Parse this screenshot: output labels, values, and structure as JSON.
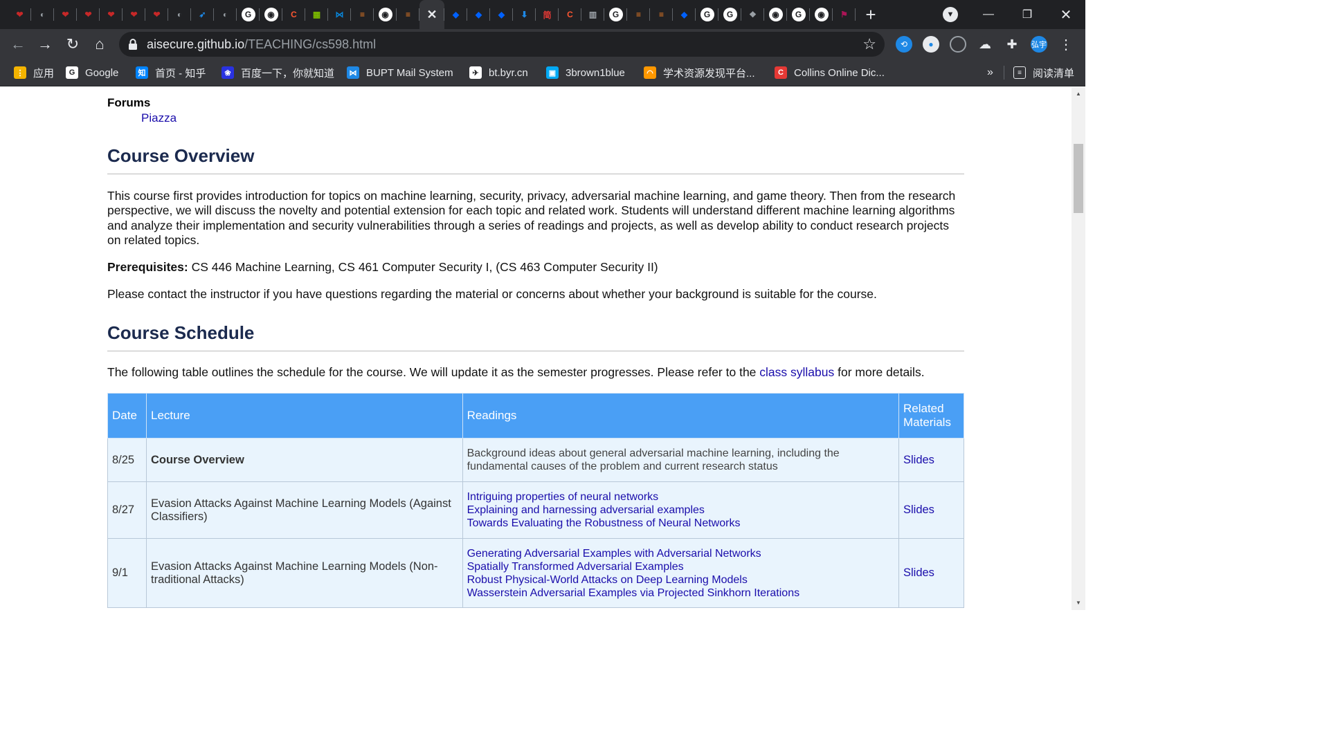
{
  "browser": {
    "tabs": [
      {
        "icon": "red-logo-icon",
        "color": "#c62828",
        "glyph": "❤"
      },
      {
        "icon": "globe-icon",
        "color": "#9aa0a6",
        "glyph": "◐"
      },
      {
        "icon": "red-logo-icon",
        "color": "#c62828",
        "glyph": "❤"
      },
      {
        "icon": "red-logo-icon",
        "color": "#c62828",
        "glyph": "❤"
      },
      {
        "icon": "red-logo-icon",
        "color": "#c62828",
        "glyph": "❤"
      },
      {
        "icon": "red-logo-icon",
        "color": "#c62828",
        "glyph": "❤"
      },
      {
        "icon": "red-logo-icon",
        "color": "#c62828",
        "glyph": "❤"
      },
      {
        "icon": "globe-icon",
        "color": "#9aa0a6",
        "glyph": "◐"
      },
      {
        "icon": "rocket-icon",
        "color": "#1e88e5",
        "glyph": "➶"
      },
      {
        "icon": "globe-icon",
        "color": "#9aa0a6",
        "glyph": "◐"
      },
      {
        "icon": "google-icon",
        "color": "#ffffff",
        "glyph": "G"
      },
      {
        "icon": "github-icon",
        "color": "#ffffff",
        "glyph": "◉"
      },
      {
        "icon": "csdn-icon",
        "color": "#fc5531",
        "glyph": "C"
      },
      {
        "icon": "microsoft-icon",
        "color": "#7cbb00",
        "glyph": "▦"
      },
      {
        "icon": "vscode-icon",
        "color": "#0a84d6",
        "glyph": "⋈"
      },
      {
        "icon": "stackoverflow-icon",
        "color": "#f48024",
        "glyph": "≡"
      },
      {
        "icon": "github-icon",
        "color": "#ffffff",
        "glyph": "◉"
      },
      {
        "icon": "stackoverflow-icon",
        "color": "#f48024",
        "glyph": "≡"
      },
      {
        "icon": "close-icon",
        "color": "#35363a",
        "glyph": "✕",
        "active": true
      },
      {
        "icon": "dropbox-icon",
        "color": "#0061fe",
        "glyph": "◆"
      },
      {
        "icon": "dropbox-icon",
        "color": "#0061fe",
        "glyph": "◆"
      },
      {
        "icon": "dropbox-icon",
        "color": "#0061fe",
        "glyph": "◆"
      },
      {
        "icon": "download-icon",
        "color": "#1e88e5",
        "glyph": "⬇"
      },
      {
        "icon": "jian-icon",
        "color": "#e53935",
        "glyph": "简"
      },
      {
        "icon": "csdn-icon",
        "color": "#fc5531",
        "glyph": "C"
      },
      {
        "icon": "reader-icon",
        "color": "#9aa0a6",
        "glyph": "▥"
      },
      {
        "icon": "google-icon",
        "color": "#ffffff",
        "glyph": "G"
      },
      {
        "icon": "stackoverflow-icon",
        "color": "#f48024",
        "glyph": "≡"
      },
      {
        "icon": "stackoverflow-icon",
        "color": "#f48024",
        "glyph": "≡"
      },
      {
        "icon": "dropbox-icon",
        "color": "#0061fe",
        "glyph": "◆"
      },
      {
        "icon": "google-icon",
        "color": "#ffffff",
        "glyph": "G"
      },
      {
        "icon": "google-icon",
        "color": "#ffffff",
        "glyph": "G"
      },
      {
        "icon": "python-icon",
        "color": "#9aa0a6",
        "glyph": "❖"
      },
      {
        "icon": "github-icon",
        "color": "#ffffff",
        "glyph": "◉"
      },
      {
        "icon": "google-icon",
        "color": "#ffffff",
        "glyph": "G"
      },
      {
        "icon": "github-icon",
        "color": "#ffffff",
        "glyph": "◉"
      },
      {
        "icon": "flag-icon",
        "color": "#ad1457",
        "glyph": "⚑"
      }
    ],
    "url_host": "aisecure.github.io",
    "url_path": "/TEACHING/cs598.html",
    "profile_label": "弘宇",
    "bookmarks": [
      {
        "label": "应用",
        "icon": "apps-grid-icon",
        "color": "#f4b400",
        "glyph": "⋮"
      },
      {
        "label": "Google",
        "icon": "google-icon",
        "color": "#ffffff",
        "glyph": "G"
      },
      {
        "label": "首页 - 知乎",
        "icon": "zhihu-icon",
        "color": "#0084ff",
        "glyph": "知"
      },
      {
        "label": "百度一下，你就知道",
        "icon": "baidu-icon",
        "color": "#2932e1",
        "glyph": "❀"
      },
      {
        "label": "BUPT Mail System",
        "icon": "mail-icon",
        "color": "#1e88e5",
        "glyph": "⋈"
      },
      {
        "label": "bt.byr.cn",
        "icon": "byr-icon",
        "color": "#ffffff",
        "glyph": "✈"
      },
      {
        "label": "3brown1blue",
        "icon": "tv-icon",
        "color": "#03a9f4",
        "glyph": "▣"
      },
      {
        "label": "学术资源发现平台...",
        "icon": "rainbow-icon",
        "color": "#ff9800",
        "glyph": "◠"
      },
      {
        "label": "Collins Online Dic...",
        "icon": "collins-icon",
        "color": "#e53935",
        "glyph": "C"
      }
    ],
    "more_bookmarks": "»",
    "reading_list": "阅读清单"
  },
  "page": {
    "forums_title": "Forums",
    "forums_link": "Piazza",
    "overview_title": "Course Overview",
    "overview_text": "This course first provides introduction for topics on machine learning, security, privacy, adversarial machine learning, and game theory. Then from the research perspective, we will discuss the novelty and potential extension for each topic and related work. Students will understand different machine learning algorithms and analyze their implementation and security vulnerabilities through a series of readings and projects, as well as develop ability to conduct research projects on related topics.",
    "prereq_label": "Prerequisites:",
    "prereq_text": " CS 446 Machine Learning, CS 461 Computer Security I, (CS 463 Computer Security II)",
    "contact_text": "Please contact the instructor if you have questions regarding the material or concerns about whether your background is suitable for the course.",
    "schedule_title": "Course Schedule",
    "schedule_intro_before": "The following table outlines the schedule for the course. We will update it as the semester progresses. Please refer to the ",
    "schedule_intro_link": "class syllabus",
    "schedule_intro_after": " for more details.",
    "table": {
      "headers": [
        "Date",
        "Lecture",
        "Readings",
        "Related Materials"
      ],
      "rows": [
        {
          "date": "8/25",
          "lecture": "Course Overview",
          "lecture_bold": true,
          "readings_text": "Background ideas about general adversarial machine learning, including the fundamental causes of the problem and current research status",
          "readings_links": [],
          "materials": "Slides"
        },
        {
          "date": "8/27",
          "lecture": "Evasion Attacks Against Machine Learning Models (Against Classifiers)",
          "lecture_bold": false,
          "readings_text": "",
          "readings_links": [
            "Intriguing properties of neural networks",
            "Explaining and harnessing adversarial examples",
            "Towards Evaluating the Robustness of Neural Networks"
          ],
          "materials": "Slides"
        },
        {
          "date": "9/1",
          "lecture": "Evasion Attacks Against Machine Learning Models (Non-traditional Attacks)",
          "lecture_bold": false,
          "readings_text": "",
          "readings_links": [
            "Generating Adversarial Examples with Adversarial Networks",
            "Spatially Transformed Adversarial Examples",
            "Robust Physical-World Attacks on Deep Learning Models",
            "Wasserstein Adversarial Examples via Projected Sinkhorn Iterations"
          ],
          "materials": "Slides"
        }
      ]
    }
  }
}
